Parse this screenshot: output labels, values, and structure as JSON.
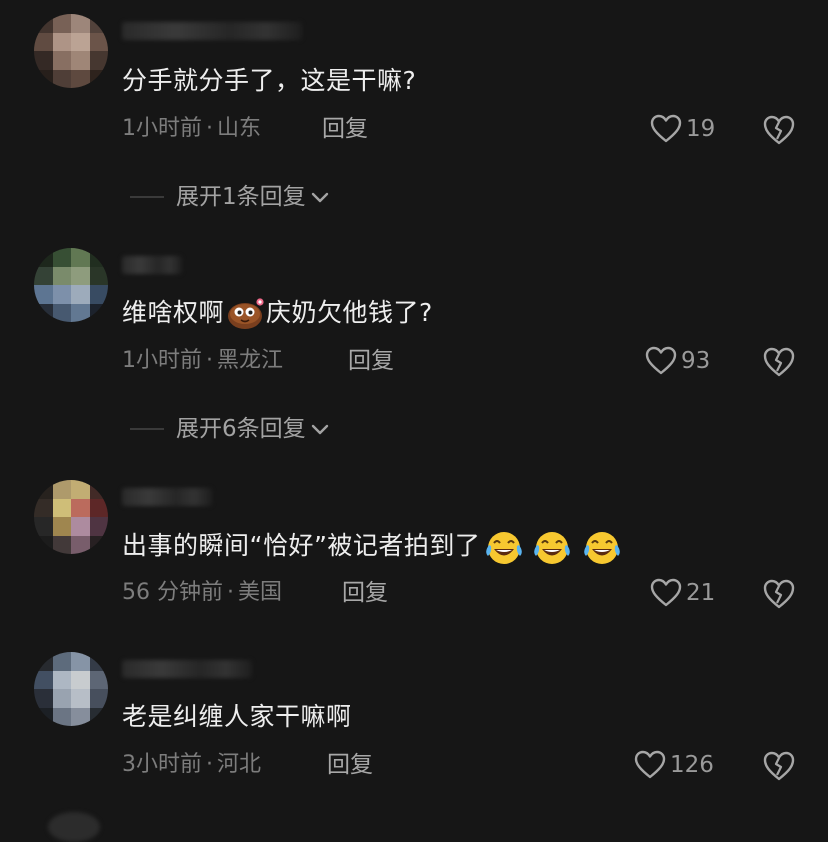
{
  "comments": [
    {
      "text": "分手就分手了，这是干嘛?",
      "time": "1小时前",
      "location": "山东",
      "reply_label": "回复",
      "likes": "19",
      "expand_label": "展开1条回复",
      "avatar_colors": [
        "#4a3a33",
        "#8a6f62",
        "#b59a8c",
        "#5d4a42",
        "#6e5549",
        "#c9ab9a",
        "#d8bcab",
        "#7a5f52",
        "#3a2d28",
        "#9c7f70",
        "#b89a89",
        "#4f3d35",
        "#2a211d",
        "#5a463d",
        "#6b5347",
        "#33261f"
      ]
    },
    {
      "text_before": "维啥权啊",
      "text_after": "庆奶欠他钱了?",
      "time": "1小时前",
      "location": "黑龙江",
      "reply_label": "回复",
      "likes": "93",
      "expand_label": "展开6条回复",
      "avatar_colors": [
        "#1f2a1e",
        "#3d5a3a",
        "#6f8a5e",
        "#243322",
        "#3a4a3c",
        "#8ca07a",
        "#a4b48f",
        "#2e3c2c",
        "#6a86a8",
        "#8fa6c4",
        "#b5c6d8",
        "#3f5570",
        "#2a3340",
        "#506580",
        "#708aa8",
        "#1e2530"
      ]
    },
    {
      "text": "出事的瞬间“恰好”被记者拍到了",
      "time": "56 分钟前",
      "location": "美国",
      "reply_label": "回复",
      "likes": "21",
      "avatar_colors": [
        "#2a2520",
        "#c9b27a",
        "#e0c884",
        "#4a2e2a",
        "#3a302a",
        "#f0dc8a",
        "#d87a6a",
        "#6a2a2a",
        "#2a2a2a",
        "#b89a5a",
        "#c8a0b8",
        "#5a3a4a",
        "#1e1e1e",
        "#4a4040",
        "#8a6a7a",
        "#2a2225"
      ]
    },
    {
      "text": "老是纠缠人家干嘛啊",
      "time": "3小时前",
      "location": "河北",
      "reply_label": "回复",
      "likes": "126",
      "avatar_colors": [
        "#2a2e34",
        "#6a7a8e",
        "#9aaac0",
        "#3a4250",
        "#4a5a70",
        "#c8d4e2",
        "#e8ecf0",
        "#6a7486",
        "#2e3440",
        "#b0bccc",
        "#d4dce6",
        "#505a6a",
        "#1e2228",
        "#7a8698",
        "#9aa4b4",
        "#2a3038"
      ]
    }
  ],
  "icons": {
    "like": "heart-outline-icon",
    "dislike": "broken-heart-icon",
    "expand": "chevron-down-icon",
    "emoji_sweat": "sweat-smile-emoji",
    "emoji_laugh": "tears-of-joy-emoji"
  },
  "colors": {
    "background": "#161616",
    "text": "#eeeeee",
    "meta": "#7d7d7d",
    "reply": "#a8a8a8"
  }
}
